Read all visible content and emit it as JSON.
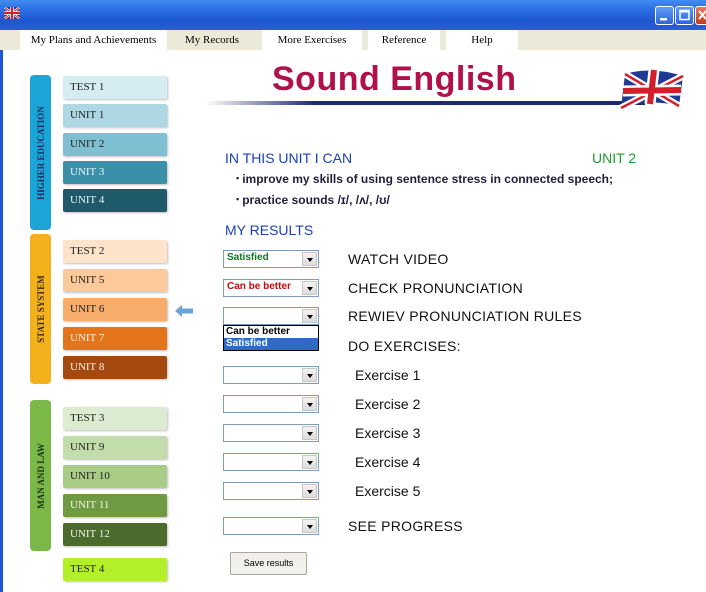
{
  "menu": {
    "items": [
      {
        "label": "My Plans and Achievements"
      },
      {
        "label": "My Records"
      },
      {
        "label": "More Exercises"
      },
      {
        "label": "Reference"
      },
      {
        "label": "Help"
      }
    ]
  },
  "logo": {
    "title": "Sound English"
  },
  "groups": [
    {
      "label": "HIGHER EDUCATION",
      "color": "#1aa5d6",
      "text_color": "#1c2a5e"
    },
    {
      "label": "STATE SYSTEM",
      "color": "#f3b21c",
      "text_color": "#3a2a05"
    },
    {
      "label": "MAN AND LAW",
      "color": "#7ab848",
      "text_color": "#1e3010"
    }
  ],
  "units": [
    {
      "label": "TEST 1",
      "bg": "#d4ecf2",
      "fg": "#222"
    },
    {
      "label": "UNIT 1",
      "bg": "#add8e3",
      "fg": "#222"
    },
    {
      "label": "UNIT 2",
      "bg": "#7ec0d2",
      "fg": "#222"
    },
    {
      "label": "UNIT 3",
      "bg": "#3b8fa8",
      "fg": "#e8f4f8"
    },
    {
      "label": "UNIT 4",
      "bg": "#1f5a6b",
      "fg": "#e8f4f8"
    },
    {
      "label": "TEST 2",
      "bg": "#fde3c9",
      "fg": "#222"
    },
    {
      "label": "UNIT 5",
      "bg": "#fbc99a",
      "fg": "#222"
    },
    {
      "label": "UNIT 6",
      "bg": "#f6ac6b",
      "fg": "#222"
    },
    {
      "label": "UNIT 7",
      "bg": "#e4741a",
      "fg": "#fff3e5"
    },
    {
      "label": "UNIT 8",
      "bg": "#a44a10",
      "fg": "#fff3e5"
    },
    {
      "label": "TEST 3",
      "bg": "#dcecd0",
      "fg": "#222"
    },
    {
      "label": "UNIT 9",
      "bg": "#c3ddaa",
      "fg": "#222"
    },
    {
      "label": "UNIT 10",
      "bg": "#a8cc86",
      "fg": "#222"
    },
    {
      "label": "UNIT 11",
      "bg": "#6f9a43",
      "fg": "#eef6e5"
    },
    {
      "label": "UNIT 12",
      "bg": "#4b6a2c",
      "fg": "#eef6e5"
    },
    {
      "label": "TEST 4",
      "bg": "#b4f02a",
      "fg": "#222"
    }
  ],
  "main": {
    "unit_heading": "IN THIS UNIT I CAN",
    "unit_label": "UNIT 2",
    "goals": [
      "improve my skills of using sentence stress in connected speech;",
      "practice sounds /ɪ/, /ʌ/, /ʊ/"
    ],
    "results_heading": "MY RESULTS"
  },
  "results": {
    "watch_video": {
      "label": "WATCH VIDEO",
      "value": "Satisfied",
      "value_color": "#0a7a1e"
    },
    "check_pronunciation": {
      "label": "CHECK PRONUNCIATION",
      "value": "Can be better",
      "value_color": "#c20a0a"
    },
    "review_rules": {
      "label": "REWIEV PRONUNCIATION RULES",
      "value": ""
    },
    "do_exercises": {
      "label": "DO EXERCISES:"
    },
    "exercises": [
      {
        "label": "Exercise 1",
        "value": ""
      },
      {
        "label": "Exercise 2",
        "value": ""
      },
      {
        "label": "Exercise 3",
        "value": ""
      },
      {
        "label": "Exercise 4",
        "value": ""
      },
      {
        "label": "Exercise 5",
        "value": ""
      }
    ],
    "see_progress": {
      "label": "SEE PROGRESS",
      "value": ""
    }
  },
  "dropdown_options": [
    "Can be better",
    "Satisfied"
  ],
  "dropdown_selected": "Satisfied",
  "save_button": "Save results"
}
